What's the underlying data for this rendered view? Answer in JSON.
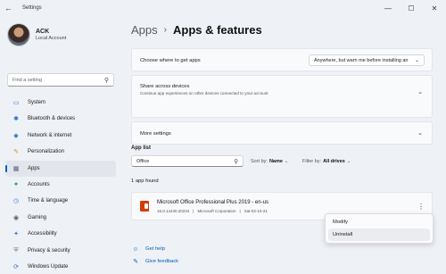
{
  "window": {
    "title": "Settings",
    "back_glyph": "←",
    "controls": [
      "—",
      "☐",
      "✕"
    ]
  },
  "profile": {
    "name": "ACK",
    "account_type": "Local Account"
  },
  "sidebar": {
    "search_placeholder": "Find a setting",
    "items": [
      {
        "label": "System",
        "icon": "monitor-icon",
        "color": "#2c7dd6",
        "glyph": "▭",
        "active": false
      },
      {
        "label": "Bluetooth & devices",
        "icon": "bluetooth-icon",
        "color": "#1e6fd0",
        "glyph": "✱",
        "active": false
      },
      {
        "label": "Network & internet",
        "icon": "wifi-icon",
        "color": "#3a80c9",
        "glyph": "◆",
        "active": false
      },
      {
        "label": "Personalization",
        "icon": "brush-icon",
        "color": "#d98b3b",
        "glyph": "✎",
        "active": false
      },
      {
        "label": "Apps",
        "icon": "apps-icon",
        "color": "#506080",
        "glyph": "▦",
        "active": true
      },
      {
        "label": "Accounts",
        "icon": "person-icon",
        "color": "#2f9b6b",
        "glyph": "●",
        "active": false
      },
      {
        "label": "Time & language",
        "icon": "globe-clock-icon",
        "color": "#2c7dd6",
        "glyph": "◷",
        "active": false
      },
      {
        "label": "Gaming",
        "icon": "gamepad-icon",
        "color": "#555e6a",
        "glyph": "◉",
        "active": false
      },
      {
        "label": "Accessibility",
        "icon": "accessibility-icon",
        "color": "#2c7dd6",
        "glyph": "✦",
        "active": false
      },
      {
        "label": "Privacy & security",
        "icon": "shield-icon",
        "color": "#6b7683",
        "glyph": "⛨",
        "active": false
      },
      {
        "label": "Windows Update",
        "icon": "update-icon",
        "color": "#1e6fd0",
        "glyph": "⟳",
        "active": false
      }
    ]
  },
  "breadcrumb": {
    "parent": "Apps",
    "separator": "›",
    "current": "Apps & features"
  },
  "settings": {
    "where_label": "Choose where to get apps",
    "where_value": "Anywhere, but warn me before installing an",
    "share_label": "Share across devices",
    "share_sub": "Continue app experiences on other devices connected to your account",
    "more_label": "More settings"
  },
  "app_list": {
    "heading": "App list",
    "search_value": "Office",
    "sort_key": "Sort by:",
    "sort_value": "Name",
    "filter_key": "Filter by:",
    "filter_value": "All drives",
    "found_text": "1 app found"
  },
  "app": {
    "name": "Microsoft Office Professional Plus 2019 - en-us",
    "version": "16.0.14430.20234",
    "publisher": "Microsoft Corporation",
    "date": "Sat-02-10-21",
    "sep": "|"
  },
  "context_menu": {
    "modify": "Modify",
    "uninstall": "Uninstall"
  },
  "help": {
    "get_help": "Get help",
    "feedback": "Give feedback"
  }
}
